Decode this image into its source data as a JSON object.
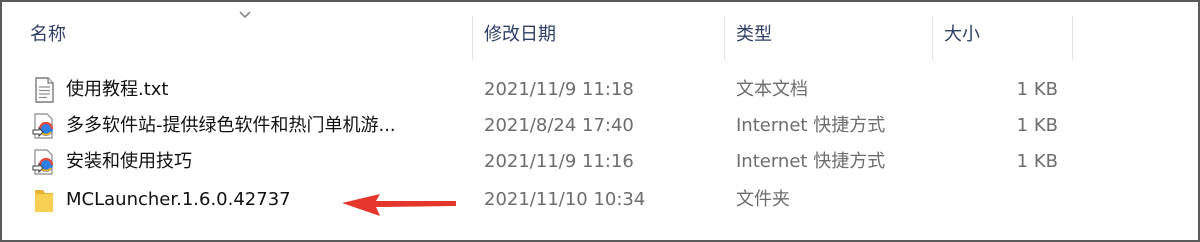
{
  "columns": {
    "name": "名称",
    "modified": "修改日期",
    "type": "类型",
    "size": "大小"
  },
  "sort_indicator_icon": "chevron-down-icon",
  "colors": {
    "header_text": "#2e3f66",
    "secondary_text": "#6d6d6d",
    "folder": "#f5c842",
    "arrow": "#e5362c"
  },
  "files": [
    {
      "icon": "text-file-icon",
      "name": "使用教程.txt",
      "modified": "2021/11/9 11:18",
      "type": "文本文档",
      "size": "1 KB"
    },
    {
      "icon": "internet-shortcut-icon",
      "name": "多多软件站-提供绿色软件和热门单机游...",
      "modified": "2021/8/24 17:40",
      "type": "Internet 快捷方式",
      "size": "1 KB"
    },
    {
      "icon": "internet-shortcut-icon",
      "name": "安装和使用技巧",
      "modified": "2021/11/9 11:16",
      "type": "Internet 快捷方式",
      "size": "1 KB"
    },
    {
      "icon": "folder-icon",
      "name": "MCLauncher.1.6.0.42737",
      "modified": "2021/11/10 10:34",
      "type": "文件夹",
      "size": ""
    }
  ],
  "annotation": {
    "icon": "red-arrow-icon",
    "points_to": "MCLauncher.1.6.0.42737"
  }
}
